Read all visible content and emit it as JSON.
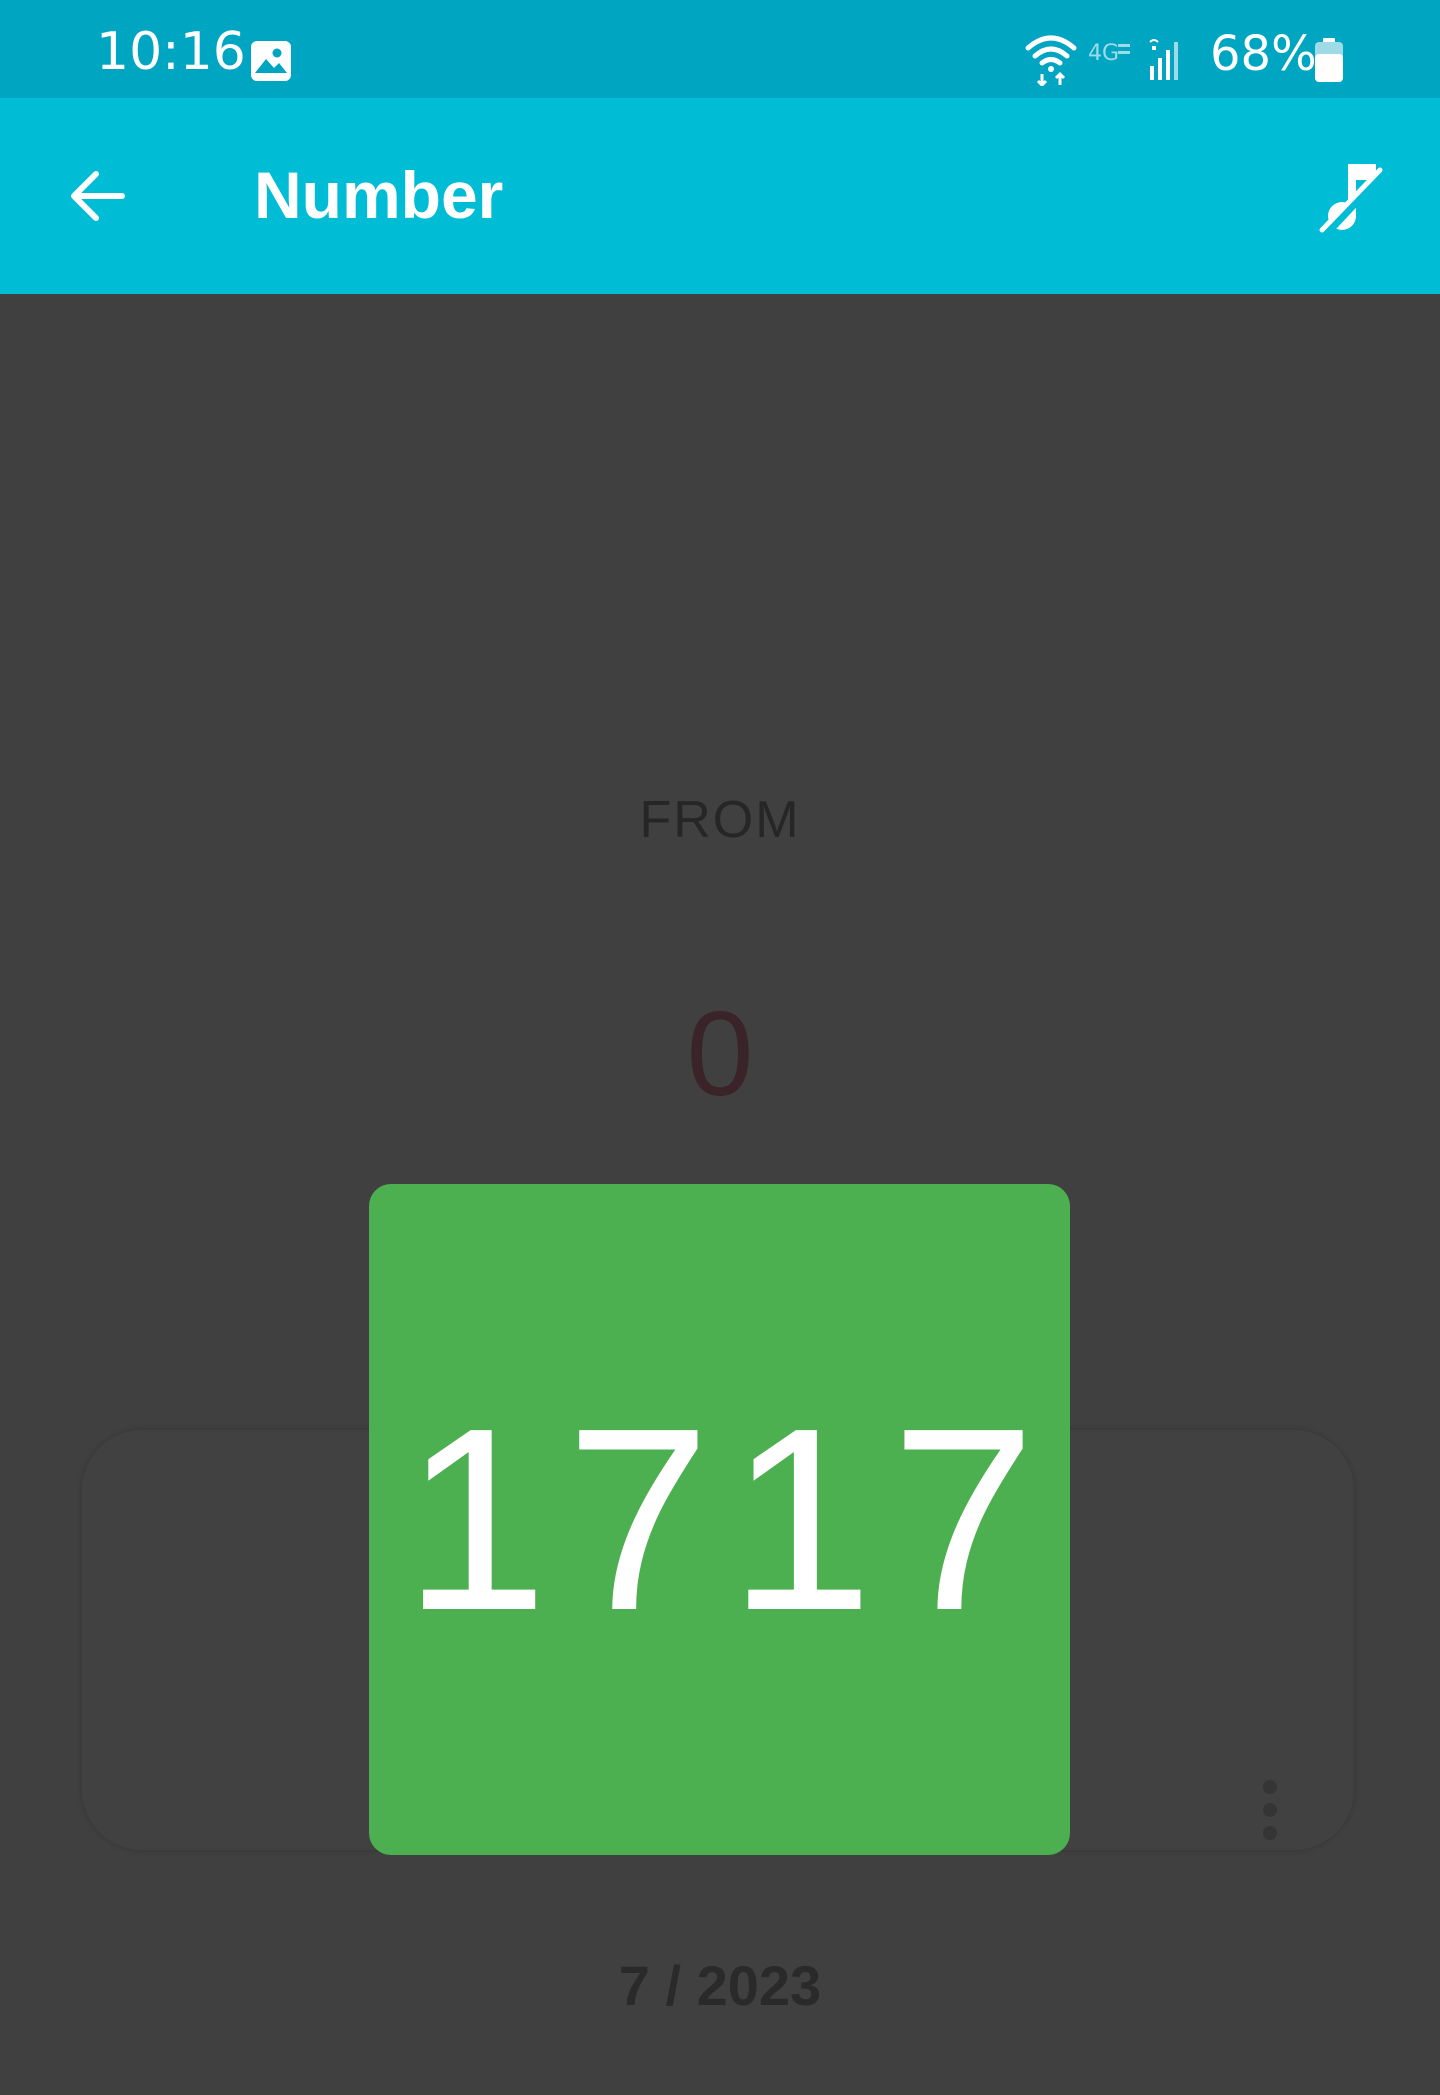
{
  "status_bar": {
    "time": "10:16",
    "battery": "68%",
    "icons": [
      "gallery-icon",
      "wifi-icon",
      "4g-lte-icon",
      "signal-icon",
      "battery-icon"
    ]
  },
  "app_bar": {
    "title": "Number",
    "back_icon": "arrow-back-icon",
    "sound_icon": "music-off-icon",
    "color": "#00bcd4"
  },
  "generator": {
    "from_label": "FROM",
    "from_value": "0",
    "result": "1717",
    "result_color": "#4caf50"
  },
  "card": {
    "date": "7 / 2023",
    "menu_icon": "more-vert-icon"
  }
}
